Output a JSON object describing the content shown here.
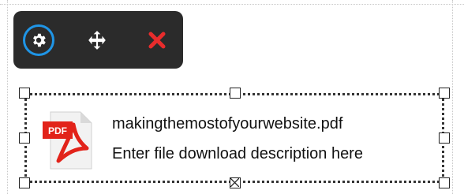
{
  "toolbar": {
    "buttons": [
      {
        "name": "settings",
        "icon": "gear-icon",
        "accent": "#1f95e6"
      },
      {
        "name": "move",
        "icon": "move-arrows-icon"
      },
      {
        "name": "delete",
        "icon": "close-icon",
        "color": "#e82c2c"
      }
    ]
  },
  "file_widget": {
    "file_name": "makingthemostofyourwebsite.pdf",
    "description": "Enter file download description here",
    "icon": "pdf-file-icon",
    "icon_badge": "PDF"
  },
  "colors": {
    "toolbar_bg": "#2b2b2b",
    "settings_ring": "#1f95e6",
    "delete_x": "#e82c2c",
    "pdf_red": "#e2231a"
  }
}
